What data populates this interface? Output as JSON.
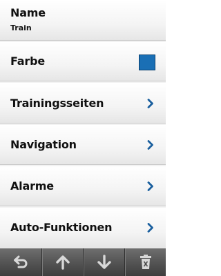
{
  "menu": {
    "items": [
      {
        "label": "Name",
        "value": "Train"
      },
      {
        "label": "Farbe",
        "color": "#1a6fb5"
      },
      {
        "label": "Trainingsseiten"
      },
      {
        "label": "Navigation"
      },
      {
        "label": "Alarme"
      },
      {
        "label": "Auto-Funktionen"
      }
    ]
  },
  "toolbar": {
    "buttons": [
      {
        "icon": "back-arrow-icon"
      },
      {
        "icon": "arrow-up-icon"
      },
      {
        "icon": "arrow-down-icon"
      },
      {
        "icon": "trash-icon"
      }
    ]
  },
  "colors": {
    "chevron": "#1a5f9e",
    "toolbar_icon": "#d8d8d8"
  }
}
